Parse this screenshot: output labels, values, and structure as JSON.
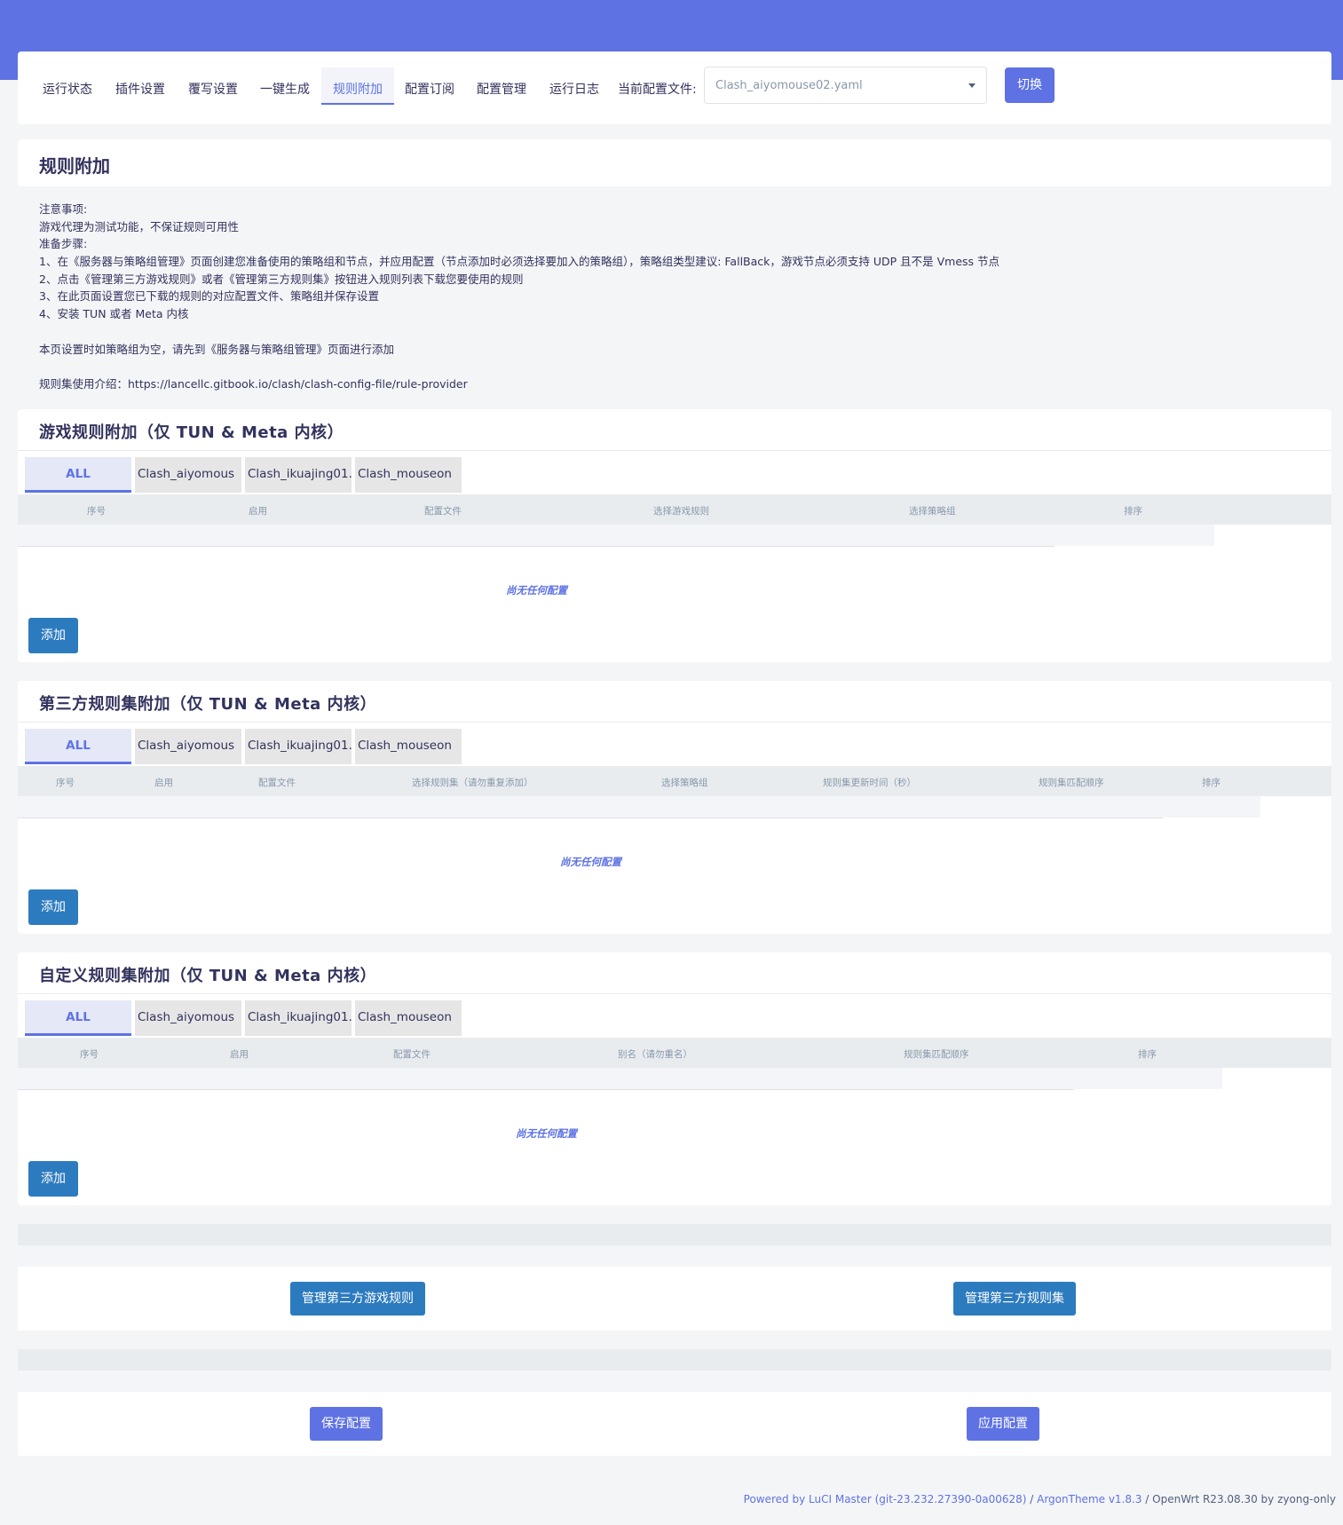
{
  "nav": {
    "tabs": [
      "运行状态",
      "插件设置",
      "覆写设置",
      "一键生成",
      "规则附加",
      "配置订阅",
      "配置管理",
      "运行日志"
    ],
    "active": "规则附加",
    "current_config_label": "当前配置文件:",
    "current_config_value": "Clash_aiyomouse02.yaml",
    "switch_label": "切换"
  },
  "page": {
    "title": "规则附加",
    "notes": [
      "注意事项:",
      "游戏代理为测试功能，不保证规则可用性",
      "准备步骤:",
      "1、在《服务器与策略组管理》页面创建您准备使用的策略组和节点，并应用配置（节点添加时必须选择要加入的策略组），策略组类型建议: FallBack，游戏节点必须支持 UDP 且不是 Vmess 节点",
      "2、点击《管理第三方游戏规则》或者《管理第三方规则集》按钮进入规则列表下载您要使用的规则",
      "3、在此页面设置您已下载的规则的对应配置文件、策略组并保存设置",
      "4、安装 TUN 或者 Meta 内核",
      "",
      "本页设置时如策略组为空，请先到《服务器与策略组管理》页面进行添加",
      "",
      "规则集使用介绍：https://lancellc.gitbook.io/clash/clash-config-file/rule-provider"
    ]
  },
  "sections": [
    {
      "title": "游戏规则附加（仅 TUN & Meta 内核）",
      "filter_tabs": [
        "ALL",
        "Clash_aiyomous",
        "Clash_ikuajing01.",
        "Clash_mouseon"
      ],
      "columns": [
        "序号",
        "启用",
        "配置文件",
        "选择游戏规则",
        "选择策略组",
        "排序"
      ],
      "empty_text": "尚无任何配置",
      "add_label": "添加"
    },
    {
      "title": "第三方规则集附加（仅 TUN & Meta 内核）",
      "filter_tabs": [
        "ALL",
        "Clash_aiyomous",
        "Clash_ikuajing01.",
        "Clash_mouseon"
      ],
      "columns": [
        "序号",
        "启用",
        "配置文件",
        "选择规则集（请勿重复添加）",
        "选择策略组",
        "规则集更新时间（秒）",
        "规则集匹配顺序",
        "排序"
      ],
      "empty_text": "尚无任何配置",
      "add_label": "添加"
    },
    {
      "title": "自定义规则集附加（仅 TUN & Meta 内核）",
      "filter_tabs": [
        "ALL",
        "Clash_aiyomous",
        "Clash_ikuajing01.",
        "Clash_mouseon"
      ],
      "columns": [
        "序号",
        "启用",
        "配置文件",
        "别名（请勿重名）",
        "规则集匹配顺序",
        "排序"
      ],
      "empty_text": "尚无任何配置",
      "add_label": "添加"
    }
  ],
  "buttons": {
    "manage_game_rules": "管理第三方游戏规则",
    "manage_rule_sets": "管理第三方规则集",
    "save_config": "保存配置",
    "apply_config": "应用配置"
  },
  "footer": {
    "powered": "Powered by LuCI Master (git-23.232.27390-0a00628)",
    "sep1": " / ",
    "theme": "ArgonTheme v1.8.3",
    "sep2": " / ",
    "os": "OpenWrt R23.08.30 by zyong-only"
  },
  "colors": {
    "accent": "#5e72e4",
    "button_blue": "#2d7bbf"
  }
}
